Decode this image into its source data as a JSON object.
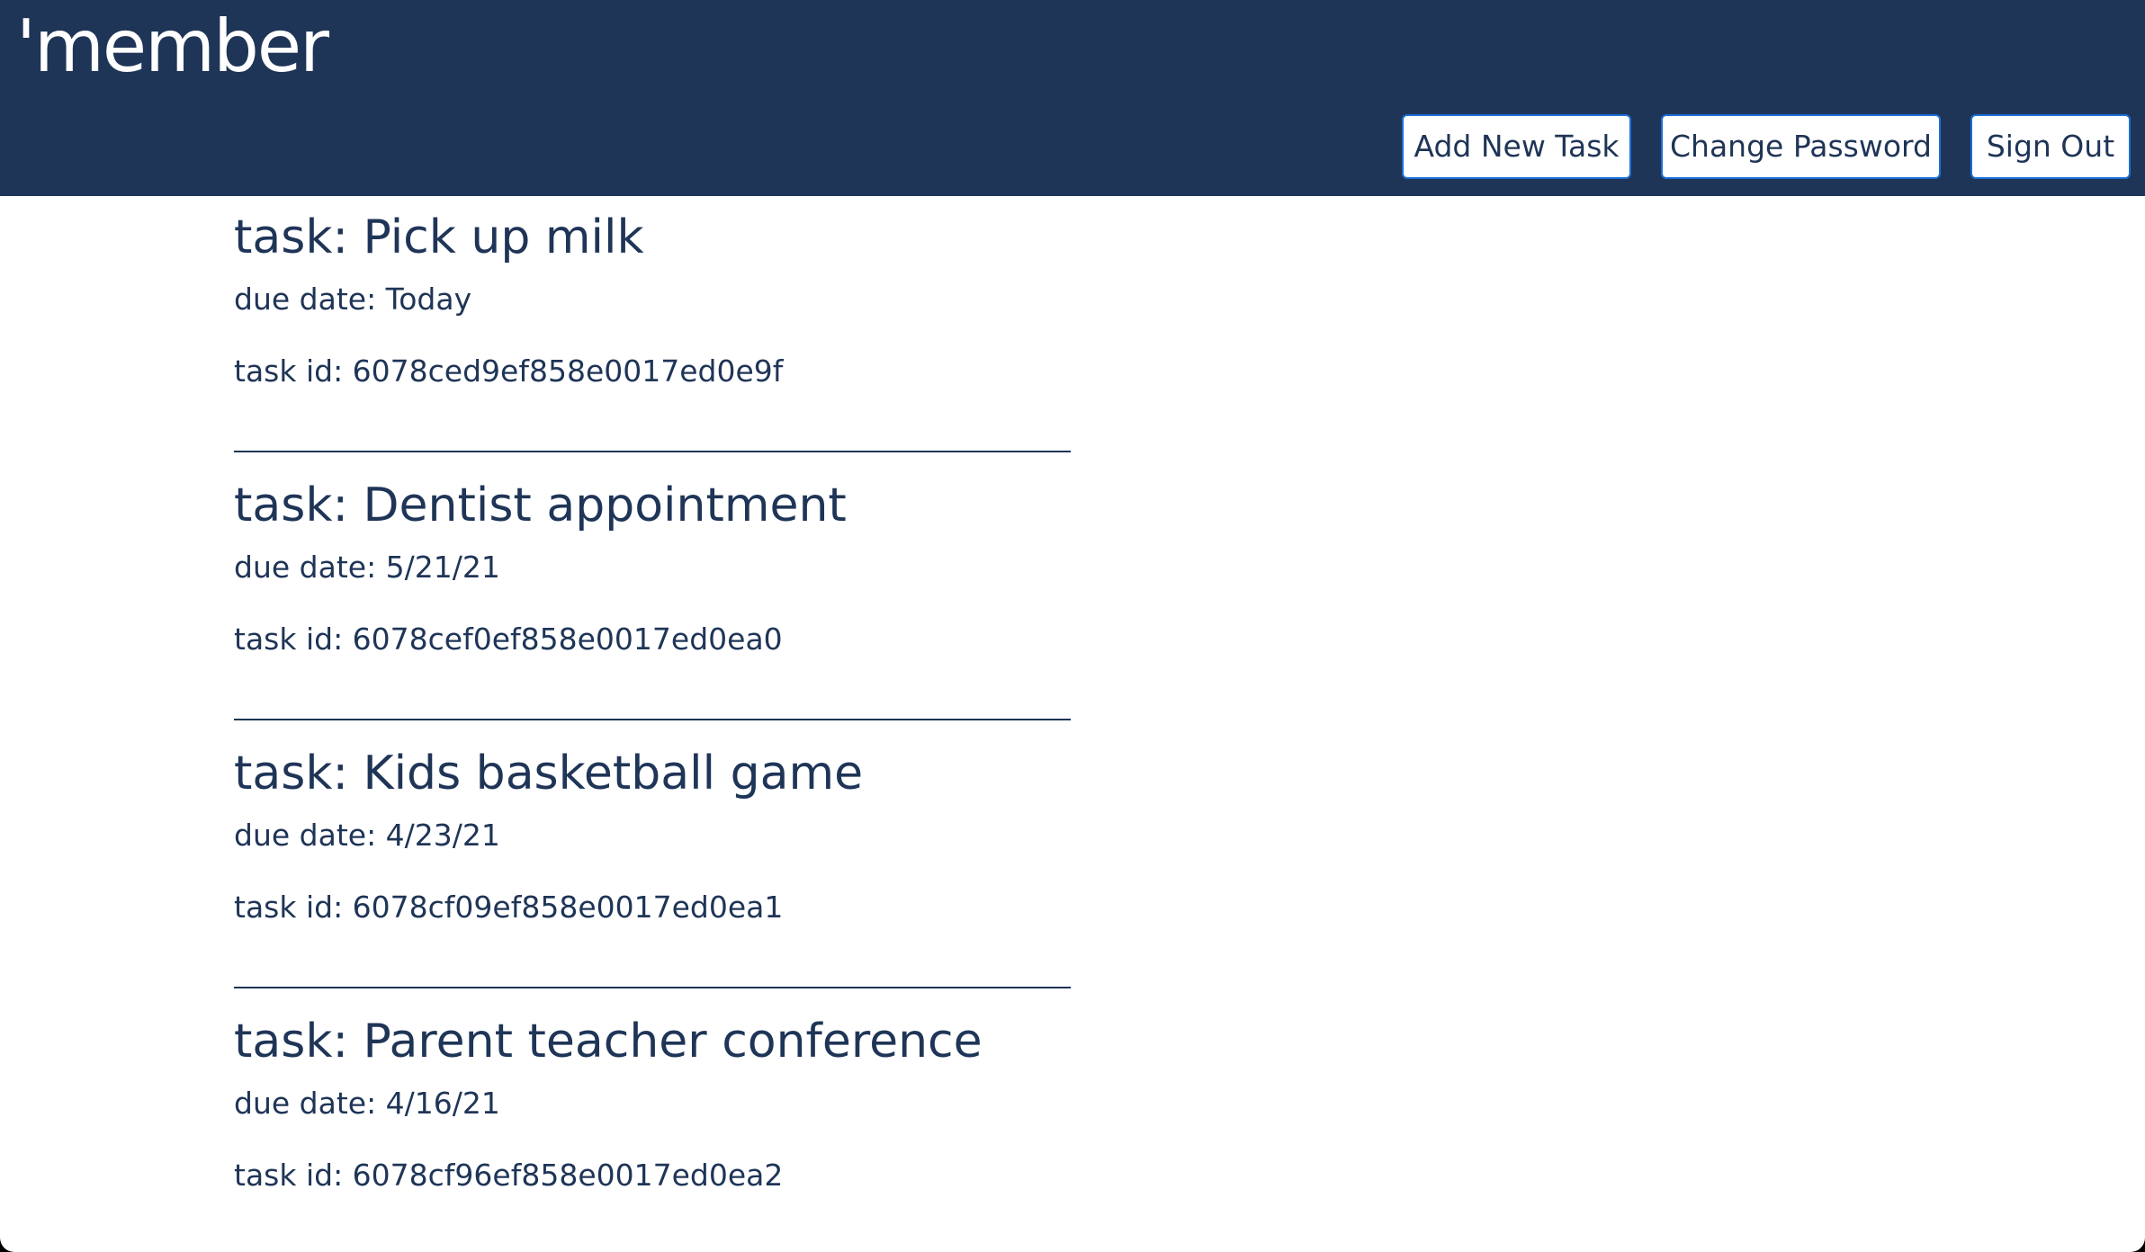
{
  "header": {
    "logo": "'member",
    "buttons": {
      "add_new_task": "Add New Task",
      "change_password": "Change Password",
      "sign_out": "Sign Out"
    }
  },
  "tasks": [
    {
      "title": "task: Pick up milk",
      "due": "due date: Today",
      "id": "task id: 6078ced9ef858e0017ed0e9f"
    },
    {
      "title": "task: Dentist appointment",
      "due": "due date: 5/21/21",
      "id": "task id: 6078cef0ef858e0017ed0ea0"
    },
    {
      "title": "task: Kids basketball game",
      "due": "due date: 4/23/21",
      "id": "task id: 6078cf09ef858e0017ed0ea1"
    },
    {
      "title": "task: Parent teacher conference",
      "due": "due date: 4/16/21",
      "id": "task id: 6078cf96ef858e0017ed0ea2"
    }
  ],
  "colors": {
    "header_bg": "#1f3557",
    "text": "#1f3557",
    "button_border": "#1a6fd8",
    "page_bg": "#ffffff"
  }
}
